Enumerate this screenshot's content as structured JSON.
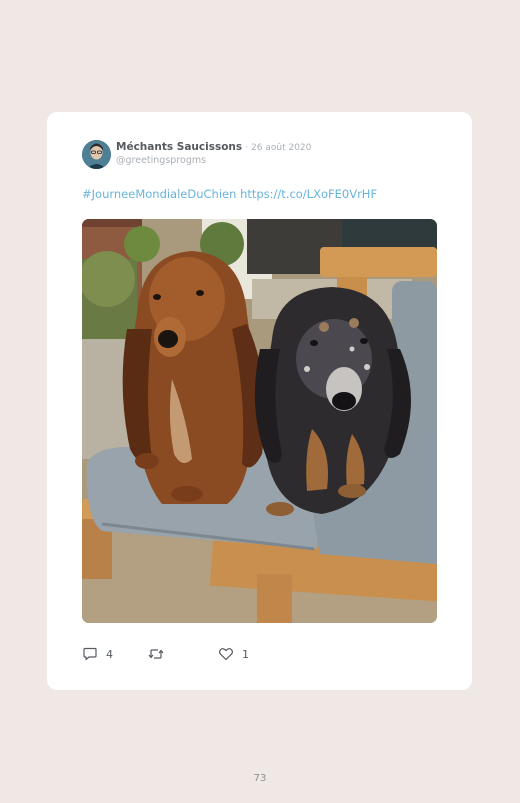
{
  "tweet": {
    "author_name": "Méchants Saucissons",
    "date": "· 26 août 2020",
    "handle": "@greetingsprogms",
    "hashtag": "#JourneeMondialeDuChien",
    "link": "https://t.co/LXoFE0VrHF",
    "reply_count": "4",
    "retweet_count": "",
    "like_count": "1",
    "photo_subject": "two long-haired dachshunds sitting on a grey cushioned wooden bench"
  },
  "icons": {
    "reply": "reply-icon",
    "retweet": "retweet-icon",
    "like": "heart-icon"
  },
  "colors": {
    "page_background": "#efe8e4",
    "card_background": "#ffffff",
    "link": "#67b3dd",
    "text": "#555a60",
    "muted": "#aab0b6"
  },
  "page": {
    "number": "73"
  }
}
